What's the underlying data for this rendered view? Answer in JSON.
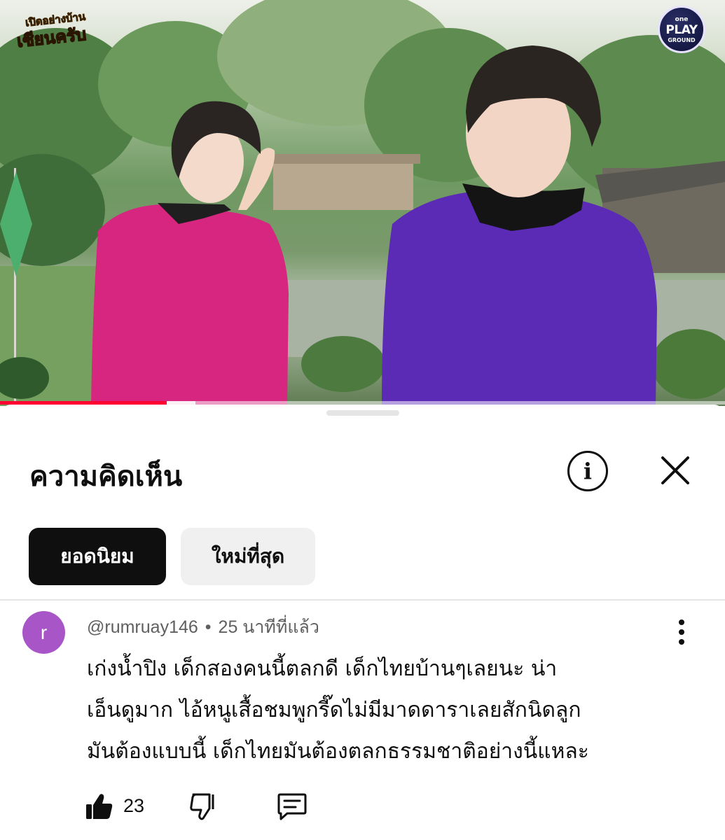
{
  "video": {
    "show_logo_line1": "เปิดอย่างบ้าน",
    "show_logo_line2": "เซียนครับ",
    "channel_badge": {
      "line1": "one",
      "line2": "PLAY",
      "line3": "GROUND"
    },
    "progress_fraction": 0.23,
    "buffered_fraction": 0.27
  },
  "comments_panel": {
    "title": "ความคิดเห็น",
    "info_icon": "info-circle-icon",
    "close_icon": "close-icon",
    "sort_chips": [
      {
        "label": "ยอดนิยม",
        "selected": true
      },
      {
        "label": "ใหม่ที่สุด",
        "selected": false
      }
    ]
  },
  "comment": {
    "avatar_letter": "r",
    "avatar_color": "#a855c7",
    "author": "@rumruay146",
    "separator": "•",
    "time": "25 นาทีที่แล้ว",
    "text_lines": [
      "เก่งน้ำปิง เด็กสองคนนี้ตลกดี เด็กไทยบ้านๆเลยนะ น่า",
      "เอ็นดูมาก ไอ้หนูเสื้อชมพูกรี๊ดไม่มีมาดดาราเลยสักนิดลูก",
      "มันต้องแบบนี้ เด็กไทยมันต้องตลกธรรมชาติอย่างนี้แหละ"
    ],
    "like_count": "23",
    "like_icon": "thumbs-up-icon",
    "dislike_icon": "thumbs-down-icon",
    "reply_icon": "comment-reply-icon",
    "more_icon": "more-vertical-icon"
  },
  "colors": {
    "accent_red": "#ff0033",
    "selected_chip_bg": "#0f0f0f",
    "unselected_chip_bg": "#f0f0f0",
    "secondary_text": "#606060",
    "pink_shirt": "#d6267f",
    "purple_shirt": "#5b2bb5"
  }
}
